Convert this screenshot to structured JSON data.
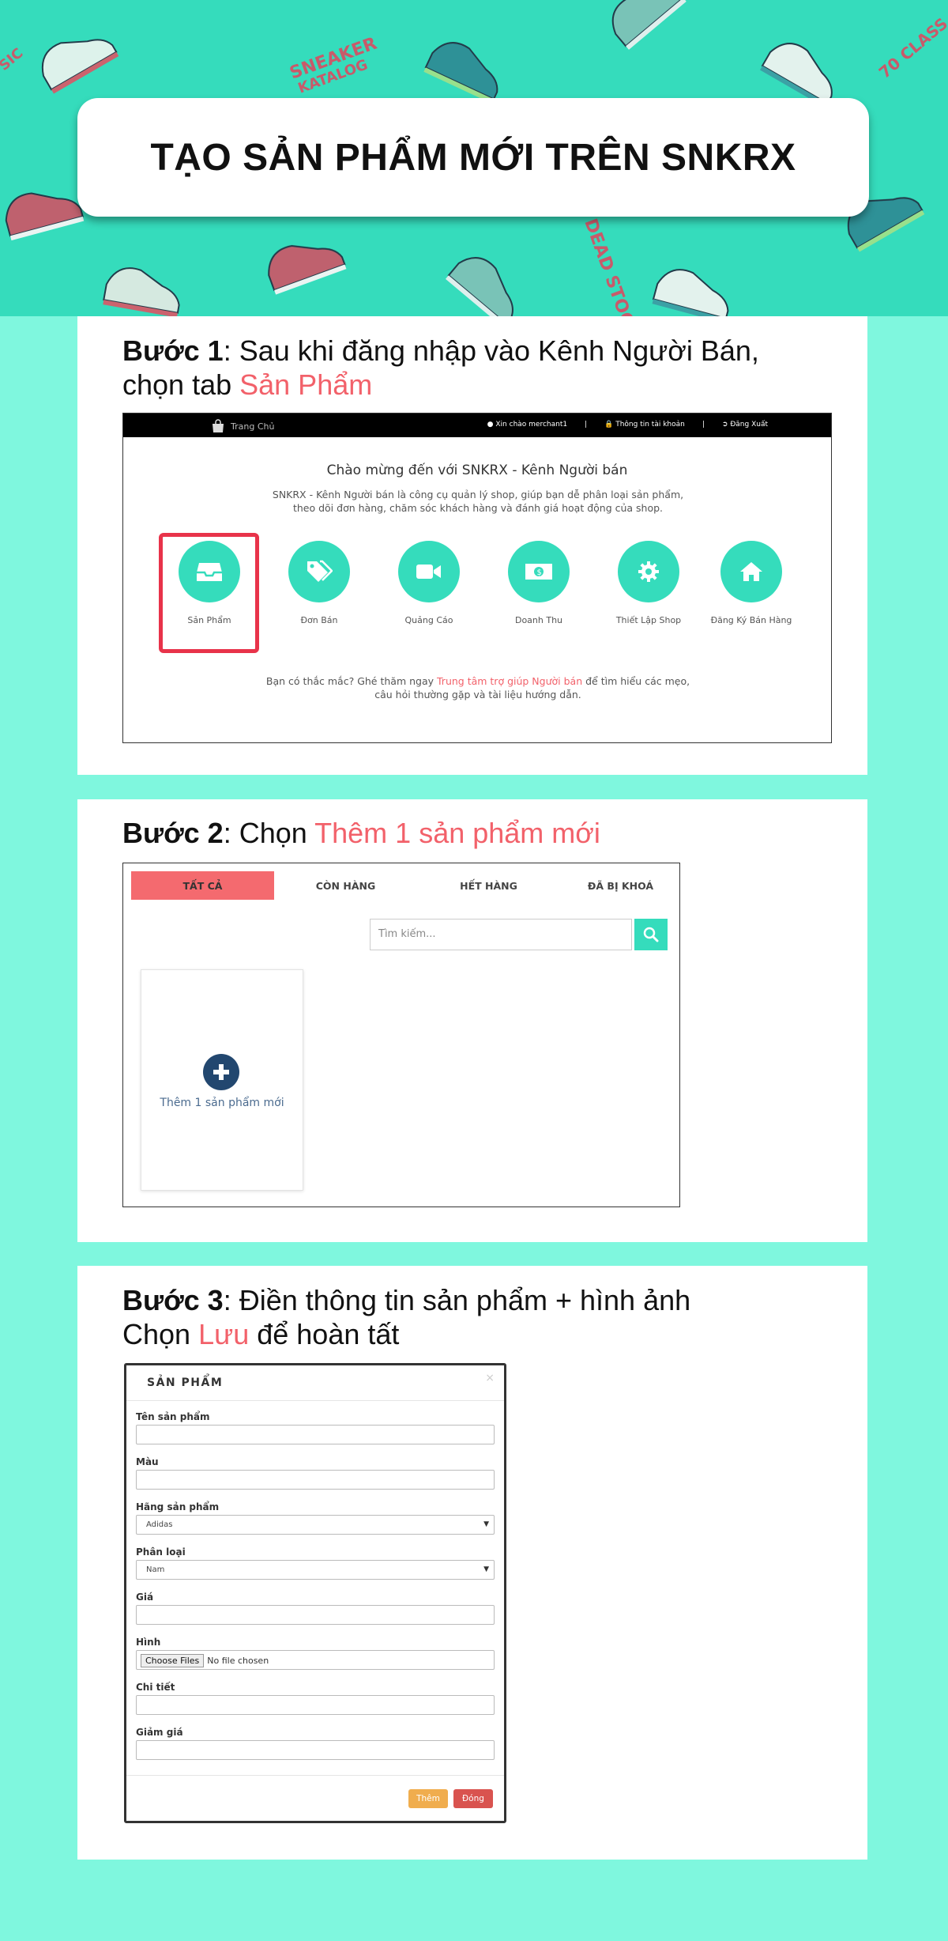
{
  "banner": {
    "background_color": "#35dcbc",
    "title": "TẠO SẢN PHẨM MỚI TRÊN SNKRX",
    "doodle_texts": [
      "SNEAKER KATALOG",
      "DEAD STOCK",
      "70 CLASS",
      "SIC"
    ]
  },
  "step1": {
    "label": "Bước 1",
    "text_line1": ": Sau khi đăng nhập vào Kênh Người Bán,",
    "text_line2_prefix": "chọn tab ",
    "text_highlight": "Sản Phẩm",
    "screenshot": {
      "home_label": "Trang Chủ",
      "greeting": "Xin chào merchant1",
      "account_info": "Thông tin tài khoản",
      "logout": "Đăng Xuất",
      "separator": "|",
      "welcome": "Chào mừng đến với SNKRX - Kênh Người bán",
      "intro_line1": "SNKRX - Kênh Người bán là công cụ quản lý shop, giúp bạn dễ phân loại sản phẩm,",
      "intro_line2": "theo dõi đơn hàng, chăm sóc khách hàng và đánh giá hoạt động của shop.",
      "features": [
        {
          "label": "Sản Phẩm",
          "icon": "inbox-icon"
        },
        {
          "label": "Đơn Bán",
          "icon": "tags-icon"
        },
        {
          "label": "Quảng Cáo",
          "icon": "video-camera-icon"
        },
        {
          "label": "Doanh Thu",
          "icon": "money-icon"
        },
        {
          "label": "Thiết Lập Shop",
          "icon": "gear-icon"
        },
        {
          "label": "Đăng Ký Bán Hàng",
          "icon": "home-icon"
        }
      ],
      "help_prefix": "Bạn có thắc mắc? Ghé thăm ngay ",
      "help_link": "Trung tâm trợ giúp Người bán",
      "help_suffix": " để tìm hiểu các mẹo,",
      "help_line2": "câu hỏi thường gặp và tài liệu hướng dẫn."
    }
  },
  "step2": {
    "label": "Bước 2",
    "text_prefix": ": Chọn ",
    "text_highlight": "Thêm 1 sản phẩm mới",
    "screenshot": {
      "tabs": [
        "TẤT CẢ",
        "CÒN HÀNG",
        "HẾT HÀNG",
        "ĐÃ BỊ KHOÁ"
      ],
      "search_placeholder": "Tìm kiếm...",
      "add_product": "Thêm 1 sản phẩm mới"
    }
  },
  "step3": {
    "label": "Bước 3",
    "text_line1": ": Điền thông tin sản phẩm + hình ảnh",
    "text_line2_prefix": "Chọn ",
    "text_highlight": "Lưu",
    "text_line2_suffix": " để hoàn tất",
    "screenshot": {
      "modal_title": "SẢN PHẨM",
      "close_x": "×",
      "fields": {
        "name": "Tên sản phẩm",
        "color": "Màu",
        "brand": "Hãng sản phẩm",
        "brand_value": "Adidas",
        "category": "Phân loại",
        "category_value": "Nam",
        "price": "Giá",
        "image": "Hình",
        "choose_files": "Choose Files",
        "no_file": "No file chosen",
        "detail": "Chi tiết",
        "discount": "Giảm giá"
      },
      "btn_add": "Thêm",
      "btn_close": "Đóng"
    }
  },
  "colors": {
    "page_background": "#7ff7de",
    "highlight": "#f2616a",
    "teal": "#35dcbc"
  }
}
